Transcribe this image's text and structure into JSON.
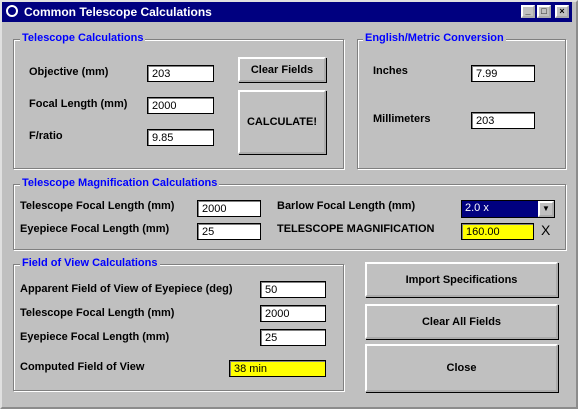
{
  "window": {
    "title": "Common Telescope Calculations",
    "minimize": "_",
    "maximize": "□",
    "close": "×"
  },
  "telescope_calc": {
    "legend": "Telescope Calculations",
    "objective_label": "Objective (mm)",
    "objective_value": "203",
    "focal_label": "Focal Length (mm)",
    "focal_value": "2000",
    "fratio_label": "F/ratio",
    "fratio_value": "9.85",
    "clear_fields": "Clear Fields",
    "calculate": "CALCULATE!"
  },
  "conversion": {
    "legend": "English/Metric Conversion",
    "inches_label": "Inches",
    "inches_value": "7.99",
    "mm_label": "Millimeters",
    "mm_value": "203"
  },
  "magnification": {
    "legend": "Telescope Magnification Calculations",
    "tfl_label": "Telescope Focal Length (mm)",
    "tfl_value": "2000",
    "efl_label": "Eyepiece Focal Length (mm)",
    "efl_value": "25",
    "barlow_label": "Barlow Focal Length (mm)",
    "barlow_value": "2.0 x",
    "mag_label": "TELESCOPE MAGNIFICATION",
    "mag_value": "160.00",
    "x_mark": "X"
  },
  "fov": {
    "legend": "Field of View Calculations",
    "afov_label": "Apparent Field of View of Eyepiece (deg)",
    "afov_value": "50",
    "tfl_label": "Telescope Focal Length (mm)",
    "tfl_value": "2000",
    "efl_label": "Eyepiece Focal Length (mm)",
    "efl_value": "25",
    "computed_label": "Computed Field of View",
    "computed_value": "38 min"
  },
  "buttons": {
    "import": "Import Specifications",
    "clear_all": "Clear All Fields",
    "close": "Close"
  },
  "colors": {
    "title_bar": "#000080",
    "legend_text": "#0000ff",
    "result_bg": "#ffff00"
  }
}
